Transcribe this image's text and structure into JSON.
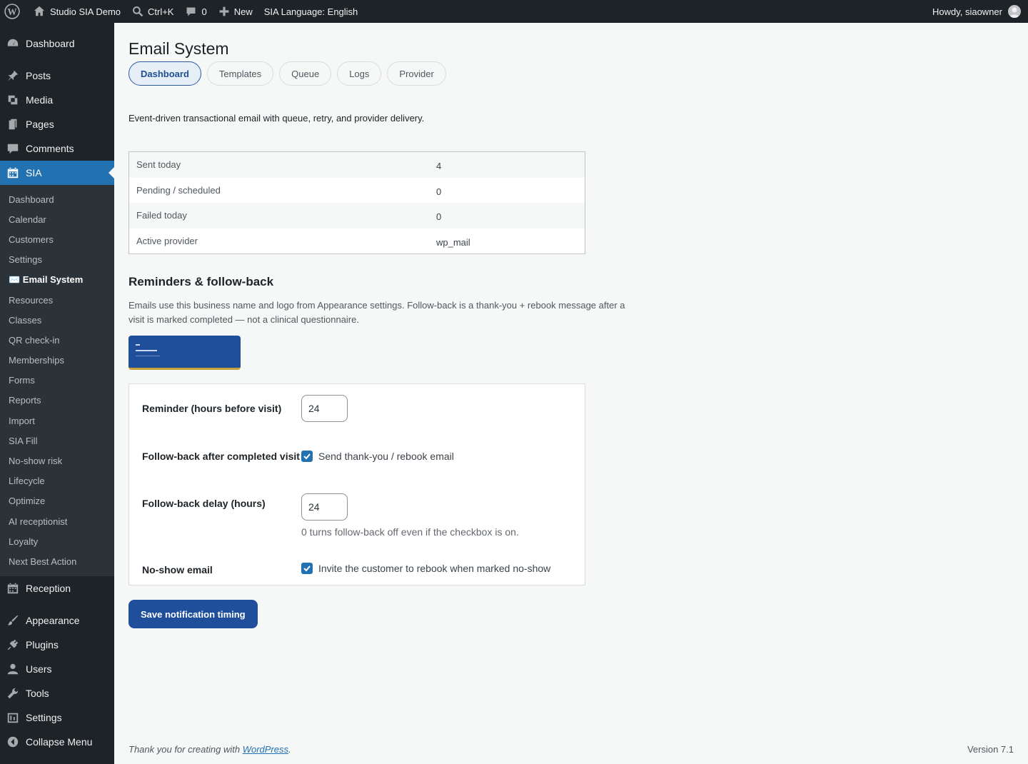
{
  "admin_bar": {
    "site_name": "Studio SIA Demo",
    "search_shortcut": "Ctrl+K",
    "comments_count": "0",
    "new_label": "New",
    "language": "SIA Language: English",
    "howdy": "Howdy, siaowner"
  },
  "sidebar": {
    "top": [
      {
        "label": "Dashboard",
        "icon": "dashboard-icon"
      }
    ],
    "group2": [
      {
        "label": "Posts",
        "icon": "pin-icon"
      },
      {
        "label": "Media",
        "icon": "media-icon"
      },
      {
        "label": "Pages",
        "icon": "pages-icon"
      },
      {
        "label": "Comments",
        "icon": "comments-icon"
      },
      {
        "label": "SIA",
        "icon": "calendar-icon"
      }
    ],
    "sia_submenu": [
      "Dashboard",
      "Calendar",
      "Customers",
      "Settings",
      "✉️ Email System",
      "Resources",
      "Classes",
      "QR check-in",
      "Memberships",
      "Forms",
      "Reports",
      "Import",
      "SIA Fill",
      "No-show risk",
      "Lifecycle",
      "Optimize",
      "AI receptionist",
      "Loyalty",
      "Next Best Action"
    ],
    "reception": {
      "label": "Reception",
      "icon": "calendar-icon"
    },
    "group3": [
      {
        "label": "Appearance",
        "icon": "brush-icon"
      },
      {
        "label": "Plugins",
        "icon": "plugin-icon"
      },
      {
        "label": "Users",
        "icon": "user-icon"
      },
      {
        "label": "Tools",
        "icon": "wrench-icon"
      },
      {
        "label": "Settings",
        "icon": "settings-icon"
      },
      {
        "label": "Collapse Menu",
        "icon": "collapse-icon"
      }
    ]
  },
  "page": {
    "title": "Email System",
    "tabs": [
      "Dashboard",
      "Templates",
      "Queue",
      "Logs",
      "Provider"
    ],
    "intro": "Event-driven transactional email with queue, retry, and provider delivery."
  },
  "stats": [
    {
      "label": "Sent today",
      "value": "4"
    },
    {
      "label": "Pending / scheduled",
      "value": "0"
    },
    {
      "label": "Failed today",
      "value": "0"
    },
    {
      "label": "Active provider",
      "value": "wp_mail"
    }
  ],
  "reminders": {
    "heading": "Reminders & follow-back",
    "description": "Emails use this business name and logo from Appearance settings. Follow-back is a thank-you + rebook message after a visit is marked completed — not a clinical questionnaire.",
    "reminder_label": "Reminder (hours before visit)",
    "reminder_value": "24",
    "followback_label": "Follow-back after completed visit",
    "followback_checkbox": "Send thank-you / rebook email",
    "followback_checked": true,
    "delay_label": "Follow-back delay (hours)",
    "delay_value": "24",
    "delay_hint": "0 turns follow-back off even if the checkbox is on.",
    "noshow_label": "No-show email",
    "noshow_checkbox": "Invite the customer to rebook when marked no-show",
    "noshow_checked": true,
    "save_label": "Save notification timing"
  },
  "footer": {
    "thanks_prefix": "Thank you for creating with ",
    "wp_link": "WordPress",
    "thanks_suffix": ".",
    "version": "Version 7.1"
  },
  "colors": {
    "admin_bg": "#1d2327",
    "accent": "#2271b1",
    "button": "#1f4f9b"
  }
}
